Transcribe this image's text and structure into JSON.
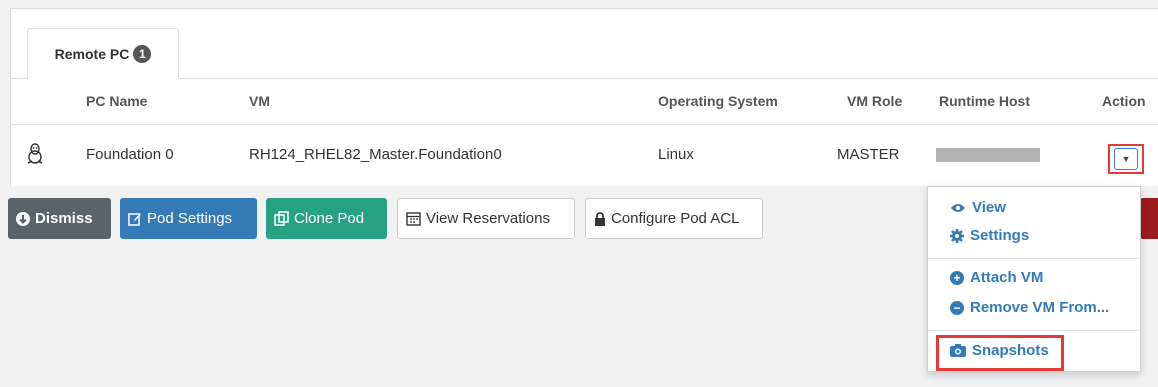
{
  "tab": {
    "label": "Remote PC",
    "count": "1"
  },
  "table": {
    "headers": {
      "pc_name": "PC Name",
      "vm": "VM",
      "os": "Operating System",
      "vm_role": "VM Role",
      "runtime_host": "Runtime Host",
      "action": "Action"
    },
    "rows": [
      {
        "pc_name": "Foundation 0",
        "vm": "RH124_RHEL82_Master.Foundation0",
        "os": "Linux",
        "vm_role": "MASTER",
        "runtime_host": "",
        "os_icon": "linux-icon"
      }
    ]
  },
  "toolbar": {
    "dismiss": "Dismiss",
    "pod_settings": "Pod Settings",
    "clone_pod": "Clone Pod",
    "view_reservations": "View Reservations",
    "configure_pod_acl": "Configure Pod ACL"
  },
  "action_menu": {
    "view": "View",
    "settings": "Settings",
    "attach_vm": "Attach VM",
    "remove_vm": "Remove VM From...",
    "snapshots": "Snapshots"
  },
  "colors": {
    "primary": "#337ab7",
    "success": "#26a283",
    "highlight": "#e53935",
    "dark": "#5a6368"
  }
}
